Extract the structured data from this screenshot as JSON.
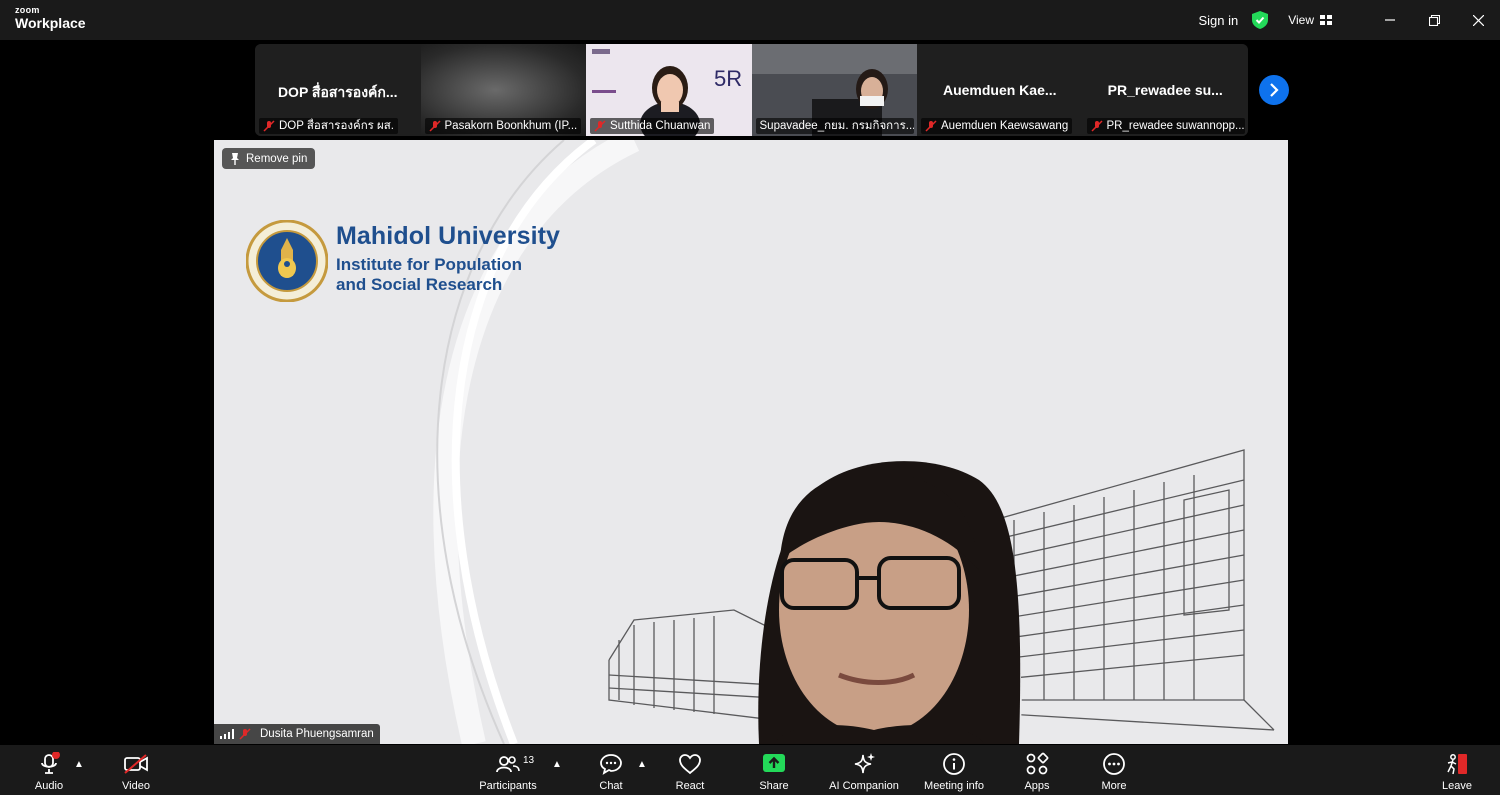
{
  "app": {
    "brand_small": "zoom",
    "brand_large": "Workplace"
  },
  "titlebar": {
    "signin": "Sign in",
    "view": "View"
  },
  "thumbnails": [
    {
      "display": "DOP สื่อสารองค์ก...",
      "name": "DOP สื่อสารองค์กร ผส."
    },
    {
      "display": "",
      "name": "Pasakorn Boonkhum (IP..."
    },
    {
      "display": "",
      "name": "Sutthida Chuanwan"
    },
    {
      "display": "",
      "name": "Supavadee_กยม. กรมกิจการ..."
    },
    {
      "display": "Auemduen Kae...",
      "name": "Auemduen Kaewsawang"
    },
    {
      "display": "PR_rewadee su...",
      "name": "PR_rewadee suwannopp..."
    }
  ],
  "main_video": {
    "pin_label": "Remove pin",
    "university": "Mahidol University",
    "institute_line1": "Institute for Population",
    "institute_line2": "and Social Research",
    "speaker_name": "Dusita Phuengsamran"
  },
  "toolbar": {
    "audio": "Audio",
    "video": "Video",
    "participants": "Participants",
    "participants_count": "13",
    "chat": "Chat",
    "react": "React",
    "share": "Share",
    "ai_companion": "AI Companion",
    "meeting_info": "Meeting info",
    "apps": "Apps",
    "more": "More",
    "leave": "Leave"
  },
  "colors": {
    "accent_blue": "#0e72ed",
    "share_green": "#23d959",
    "leave_red": "#e02828",
    "muted_red": "#e02828",
    "mahidol_blue": "#1f4f8e"
  }
}
